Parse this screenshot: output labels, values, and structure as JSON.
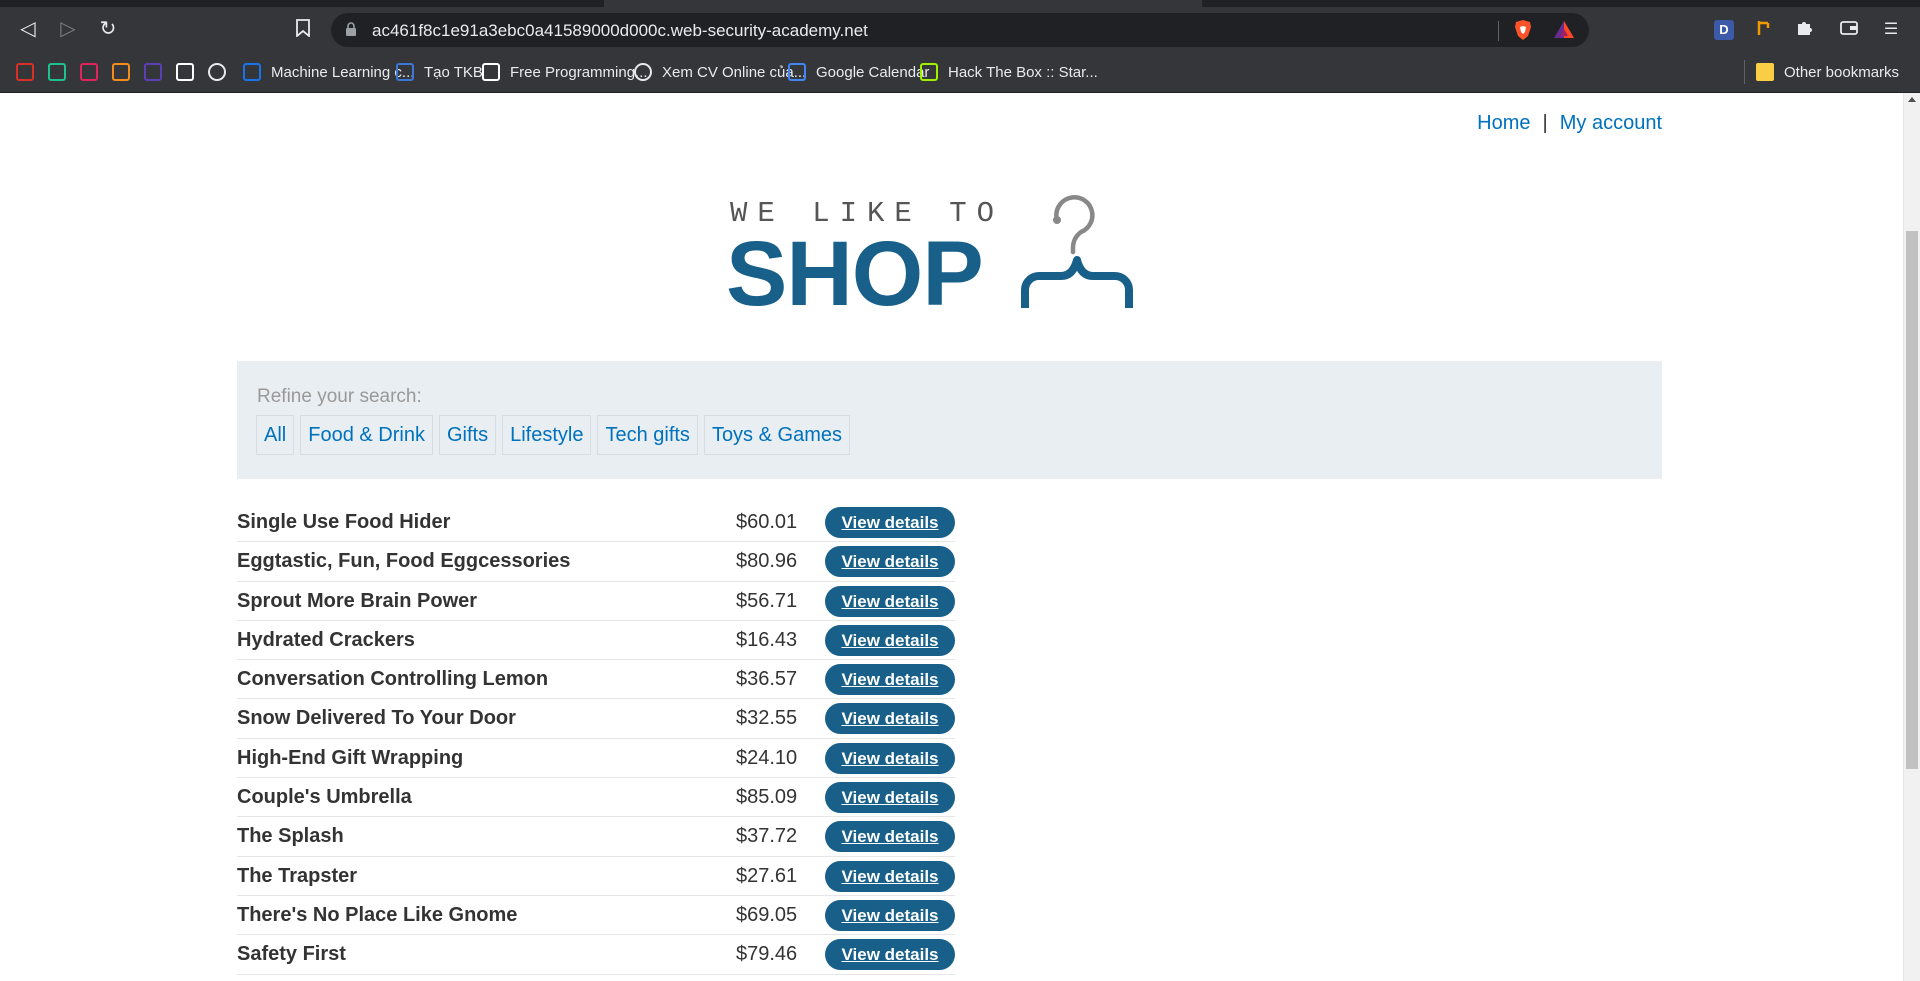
{
  "browser": {
    "url": "ac461f8c1e91a3ebc0a41589000d000c.web-security-academy.net",
    "bookmarks": [
      {
        "label": "",
        "icon": "castle-icon",
        "color": "#d93025"
      },
      {
        "label": "",
        "icon": "n-icon",
        "color": "#1fbf8f"
      },
      {
        "label": "",
        "icon": "t-icon",
        "color": "#e0245e"
      },
      {
        "label": "",
        "icon": "a-icon",
        "color": "#f28c1a"
      },
      {
        "label": "",
        "icon": "bolt-icon",
        "color": "#5b3fb6"
      },
      {
        "label": "",
        "icon": "tiger-icon",
        "color": "#ffffff"
      },
      {
        "label": "",
        "icon": "globe-icon",
        "color": "#e8eaed"
      },
      {
        "label": "Machine Learning c...",
        "icon": "ship-icon",
        "color": "#1a73e8"
      },
      {
        "label": "Tạo TKB",
        "icon": "swirl-icon",
        "color": "#3c78d8"
      },
      {
        "label": "Free Programming...",
        "icon": "book-icon",
        "color": "#ffffff"
      },
      {
        "label": "Xem CV Online của...",
        "icon": "globe-icon",
        "color": "#e8eaed"
      },
      {
        "label": "Google Calendar",
        "icon": "calendar-icon",
        "color": "#4285f4"
      },
      {
        "label": "Hack The Box :: Star...",
        "icon": "cube-icon",
        "color": "#9fef00"
      }
    ],
    "other_bookmarks": "Other bookmarks"
  },
  "nav": {
    "home": "Home",
    "separator": "|",
    "account": "My account"
  },
  "logo": {
    "tagline": "WE LIKE TO",
    "title": "SHOP"
  },
  "filter": {
    "label": "Refine your search:",
    "categories": [
      "All",
      "Food & Drink",
      "Gifts",
      "Lifestyle",
      "Tech gifts",
      "Toys & Games"
    ]
  },
  "button_label": "View details",
  "products": [
    {
      "name": "Single Use Food Hider",
      "price": "$60.01"
    },
    {
      "name": "Eggtastic, Fun, Food Eggcessories",
      "price": "$80.96"
    },
    {
      "name": "Sprout More Brain Power",
      "price": "$56.71"
    },
    {
      "name": "Hydrated Crackers",
      "price": "$16.43"
    },
    {
      "name": "Conversation Controlling Lemon",
      "price": "$36.57"
    },
    {
      "name": "Snow Delivered To Your Door",
      "price": "$32.55"
    },
    {
      "name": "High-End Gift Wrapping",
      "price": "$24.10"
    },
    {
      "name": "Couple's Umbrella",
      "price": "$85.09"
    },
    {
      "name": "The Splash",
      "price": "$37.72"
    },
    {
      "name": "The Trapster",
      "price": "$27.61"
    },
    {
      "name": "There's No Place Like Gnome",
      "price": "$69.05"
    },
    {
      "name": "Safety First",
      "price": "$79.46"
    }
  ]
}
